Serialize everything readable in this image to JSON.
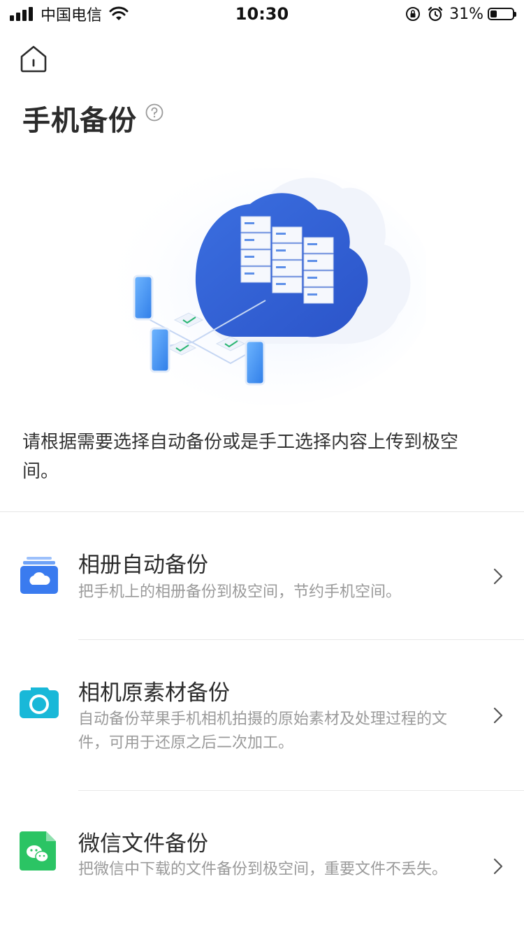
{
  "status_bar": {
    "carrier": "中国电信",
    "time": "10:30",
    "battery_percent": "31%",
    "battery_level": 0.31,
    "icons": [
      "signal-icon",
      "wifi-icon",
      "rotation-lock-icon",
      "alarm-icon",
      "battery-icon"
    ]
  },
  "header": {
    "home_icon": "home-icon",
    "title": "手机备份",
    "help_icon": "question-circle-icon"
  },
  "hero": {
    "illustration": "cloud-server-phones-illustration"
  },
  "description": "请根据需要选择自动备份或是手工选择内容上传到极空间。",
  "options": [
    {
      "icon": "album-cloud-icon",
      "title": "相册自动备份",
      "desc": "把手机上的相册备份到极空间，节约手机空间。",
      "color": "#3a7bef"
    },
    {
      "icon": "camera-icon",
      "title": "相机原素材备份",
      "desc": "自动备份苹果手机相机拍摄的原始素材及处理过程的文件，可用于还原之后二次加工。",
      "color": "#19b8d8"
    },
    {
      "icon": "wechat-file-icon",
      "title": "微信文件备份",
      "desc": "把微信中下载的文件备份到极空间，重要文件不丢失。",
      "color": "#2bc464"
    }
  ],
  "colors": {
    "accent_blue": "#3a7bef",
    "text_primary": "#2b2b2b",
    "text_secondary": "#9a9a9a"
  }
}
